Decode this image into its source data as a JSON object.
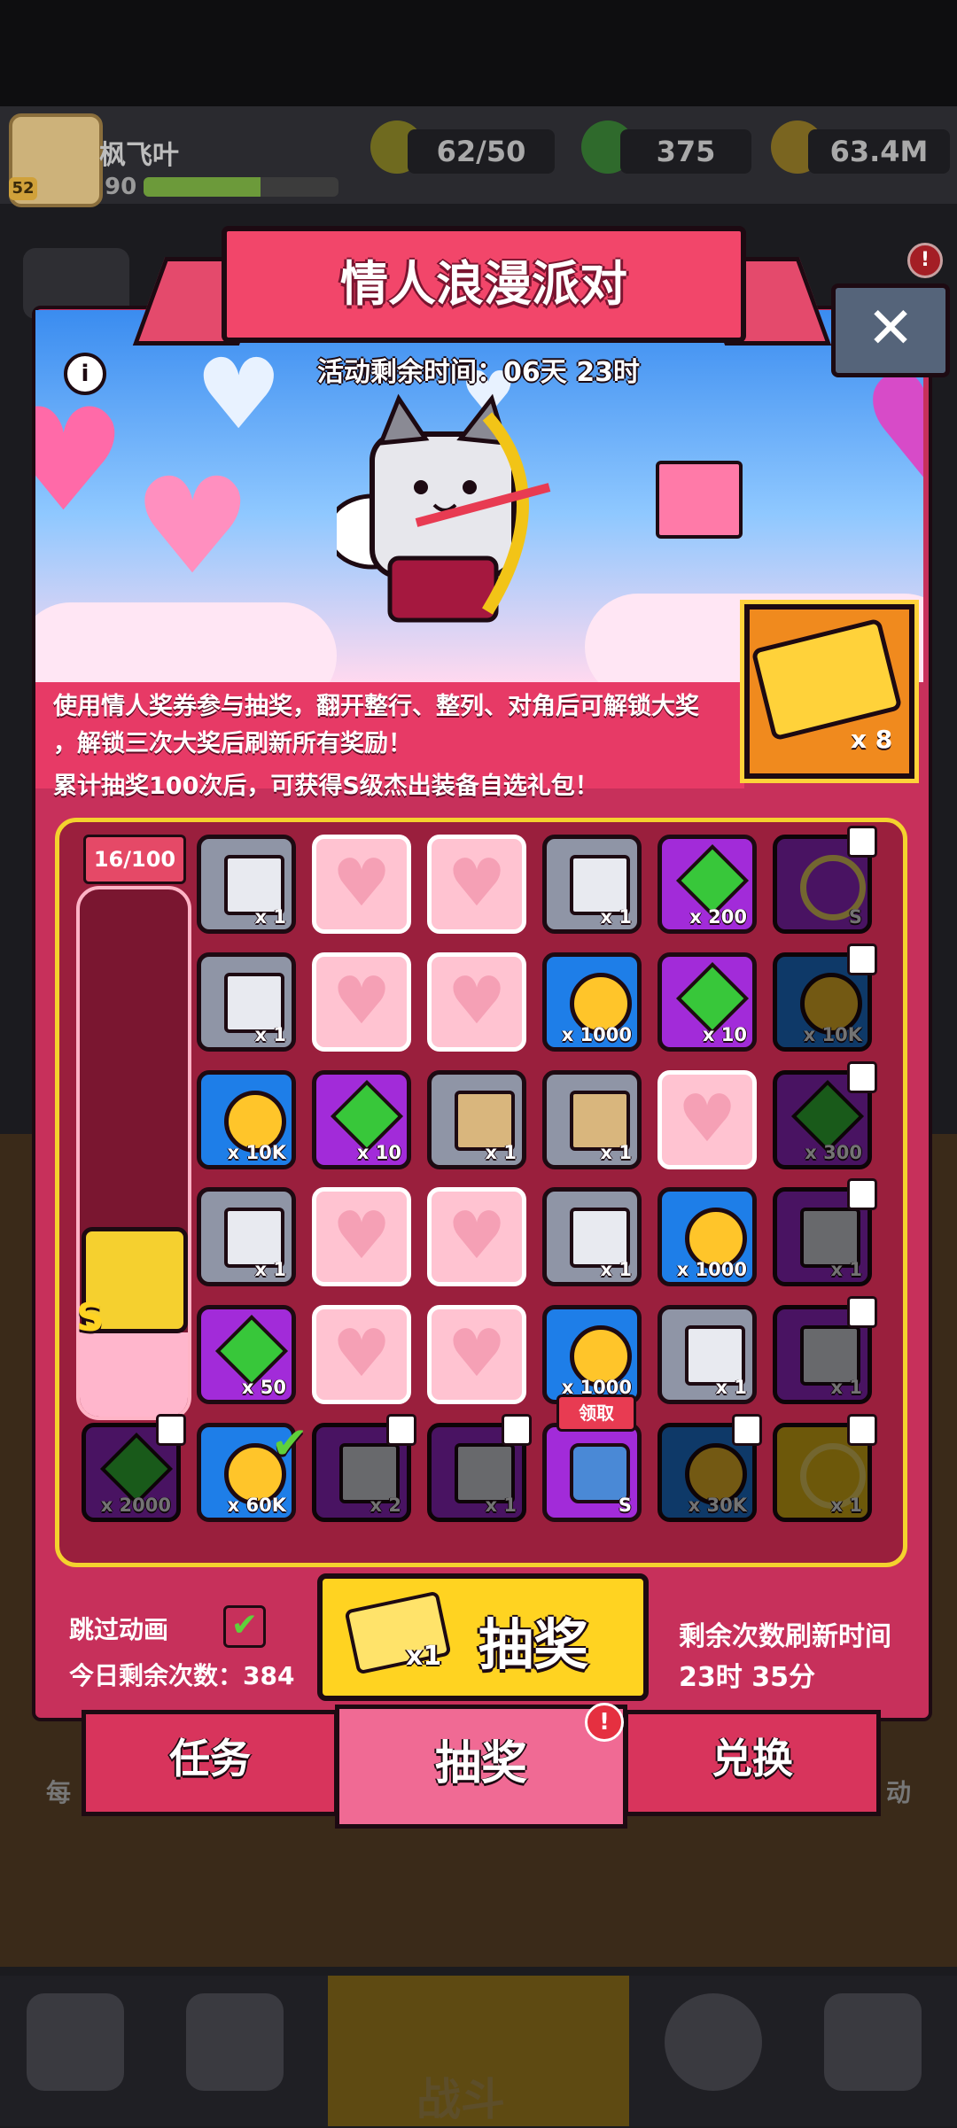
{
  "player": {
    "name": "枫飞叶",
    "level_badge": "52",
    "level": "90",
    "xp_fraction": 0.6
  },
  "resources": {
    "energy": "62/50",
    "gems": "375",
    "coins": "63.4M"
  },
  "event": {
    "title": "情人浪漫派对",
    "timer_label": "活动剩余时间：06天 23时",
    "info_icon": "i",
    "close_icon": "✕",
    "description_lines": [
      "使用情人奖券参与抽奖，翻开整行、整列、对角后可解锁大奖",
      "，解锁三次大奖后刷新所有奖励！",
      "累计抽奖100次后，可获得S级杰出装备自选礼包！"
    ],
    "tickets_owned": "x 8"
  },
  "progress": {
    "label": "16/100",
    "fraction": 0.16,
    "grand_prize_tier": "S"
  },
  "grid": {
    "rows": [
      [
        {
          "type": "grey",
          "icon": "mystery-chest-icon",
          "count": "x 1"
        },
        {
          "type": "heart"
        },
        {
          "type": "heart"
        },
        {
          "type": "grey",
          "icon": "gear-chest-icon",
          "count": "x 1"
        },
        {
          "type": "purple",
          "icon": "gem-icon",
          "count": "x 200"
        },
        {
          "type": "purple",
          "icon": "s-equipment-belt-icon",
          "count": "S",
          "locked": true
        }
      ],
      [
        {
          "type": "grey",
          "icon": "gear-chest-icon",
          "count": "x 1"
        },
        {
          "type": "heart"
        },
        {
          "type": "heart"
        },
        {
          "type": "blue",
          "icon": "coin-icon",
          "count": "x 1000"
        },
        {
          "type": "purple",
          "icon": "gem-icon",
          "count": "x 10"
        },
        {
          "type": "blue",
          "icon": "coin-icon",
          "count": "x 10K",
          "locked": true
        }
      ],
      [
        {
          "type": "blue",
          "icon": "coin-icon",
          "count": "x 10K"
        },
        {
          "type": "purple",
          "icon": "gem-icon",
          "count": "x 10"
        },
        {
          "type": "grey",
          "icon": "scroll-icon",
          "count": "x 1"
        },
        {
          "type": "grey",
          "icon": "scroll-icon",
          "count": "x 1"
        },
        {
          "type": "heart"
        },
        {
          "type": "purple",
          "icon": "gem-icon",
          "count": "x 300",
          "locked": true
        }
      ],
      [
        {
          "type": "grey",
          "icon": "gear-chest-icon",
          "count": "x 1"
        },
        {
          "type": "heart"
        },
        {
          "type": "heart"
        },
        {
          "type": "grey",
          "icon": "mystery-chest-icon",
          "count": "x 1"
        },
        {
          "type": "blue",
          "icon": "coin-icon",
          "count": "x 1000"
        },
        {
          "type": "purple",
          "icon": "glove-chest-icon",
          "count": "x 1",
          "locked": true
        }
      ],
      [
        {
          "type": "purple",
          "icon": "gem-icon",
          "count": "x 50"
        },
        {
          "type": "heart"
        },
        {
          "type": "heart"
        },
        {
          "type": "blue",
          "icon": "coin-icon",
          "count": "x 1000"
        },
        {
          "type": "grey",
          "icon": "gear-chest-icon",
          "count": "x 1"
        },
        {
          "type": "purple",
          "icon": "gear-chest-icon",
          "count": "x 1",
          "locked": true
        }
      ]
    ],
    "bonus_row": [
      {
        "type": "purple",
        "icon": "gem-icon",
        "count": "x 2000",
        "locked": true
      },
      {
        "type": "blue",
        "icon": "coin-icon",
        "count": "x 60K",
        "checked": true
      },
      {
        "type": "purple",
        "icon": "gear-chest-icon",
        "count": "x 2",
        "locked": true
      },
      {
        "type": "purple",
        "icon": "armor-chest-icon",
        "count": "x 1",
        "locked": true
      },
      {
        "type": "purple",
        "icon": "s-equipment-robot-icon",
        "count": "S",
        "claim_label": "领取"
      },
      {
        "type": "blue",
        "icon": "coin-icon",
        "count": "x 30K",
        "locked": true
      },
      {
        "type": "gold",
        "icon": "halo-icon",
        "count": "x 1",
        "locked": true
      }
    ]
  },
  "draw": {
    "skip_label": "跳过动画",
    "skip_checked": "✔",
    "remaining_label": "今日剩余次数：384",
    "button_label": "抽奖",
    "button_cost": "x1",
    "refresh_label": "剩余次数刷新时间",
    "refresh_time": "23时 35分"
  },
  "tabs": [
    {
      "label": "任务"
    },
    {
      "label": "抽奖",
      "active": true,
      "alert": "!"
    },
    {
      "label": "兑换"
    }
  ],
  "background": {
    "side_left_label": "每",
    "side_right_label": "动",
    "bottom_nav_active": "战斗"
  },
  "colors": {
    "modal": "#c7305b",
    "panel": "#9a1f3d",
    "border_gold": "#f4d22e",
    "button_yellow": "#ffd321"
  }
}
